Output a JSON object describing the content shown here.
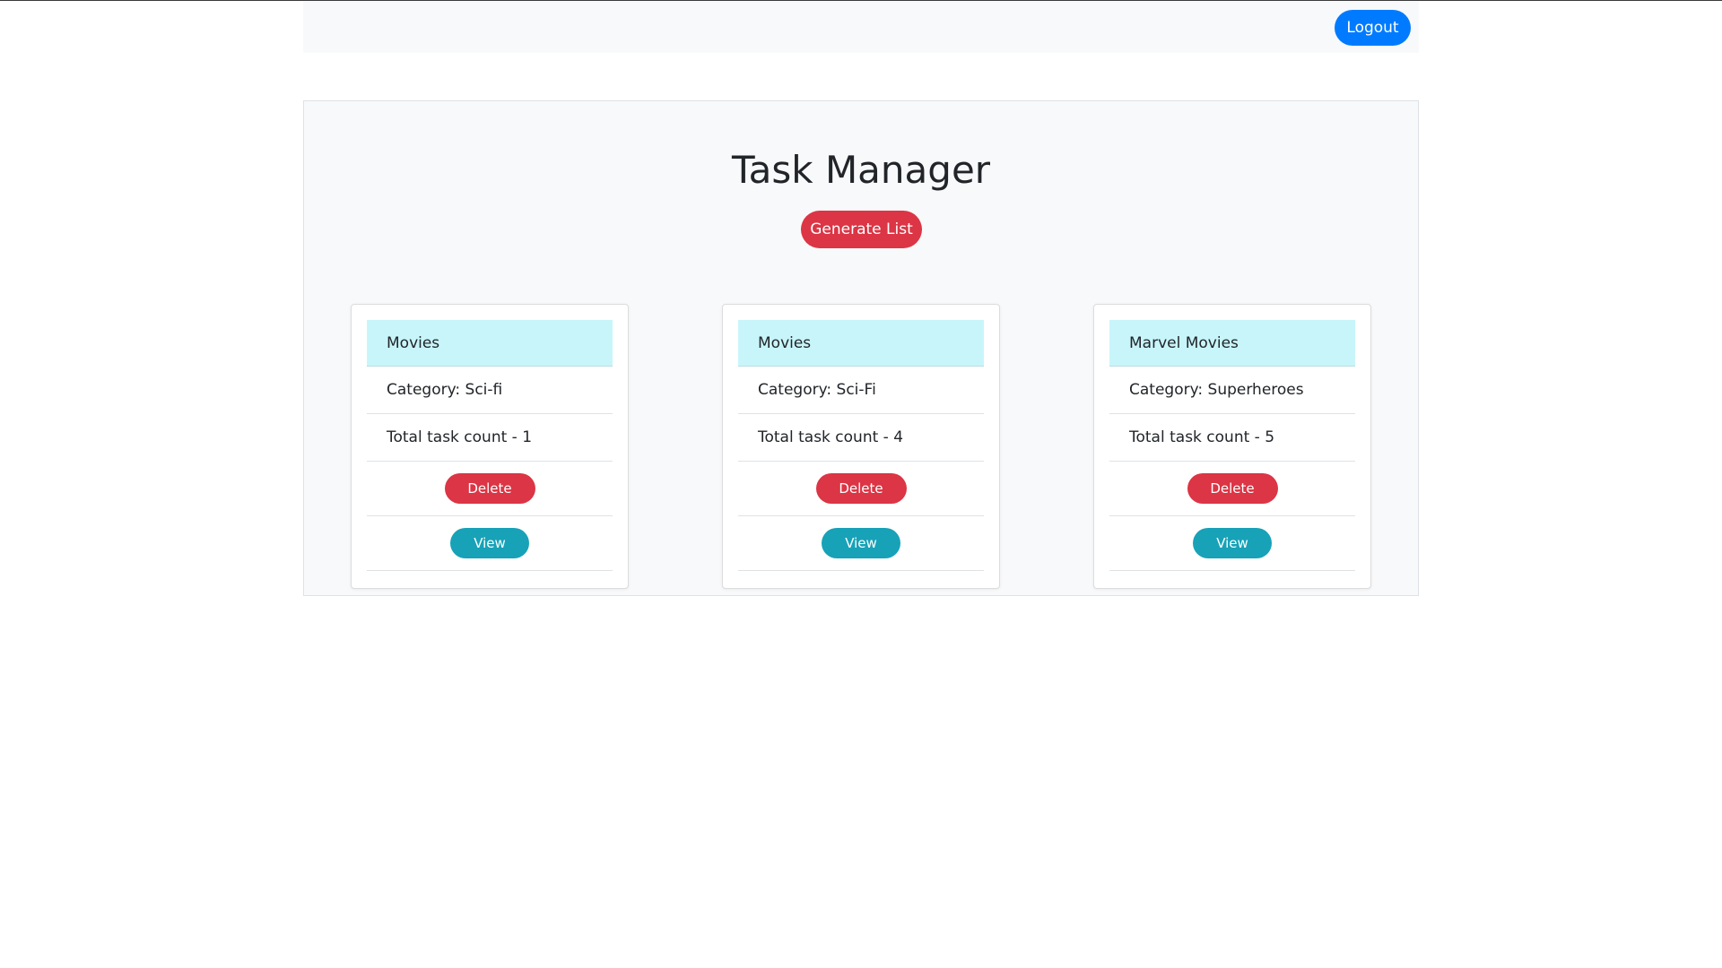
{
  "navbar": {
    "logout_label": "Logout"
  },
  "main": {
    "title": "Task Manager",
    "generate_label": "Generate List"
  },
  "cards": [
    {
      "title": "Movies",
      "category": "Category: Sci-fi",
      "count": "Total task count - 1",
      "delete_label": "Delete",
      "view_label": "View"
    },
    {
      "title": "Movies",
      "category": "Category: Sci-Fi",
      "count": "Total task count - 4",
      "delete_label": "Delete",
      "view_label": "View"
    },
    {
      "title": "Marvel Movies",
      "category": "Category: Superheroes",
      "count": "Total task count - 5",
      "delete_label": "Delete",
      "view_label": "View"
    }
  ],
  "colors": {
    "primary": "#007bff",
    "danger": "#dc3545",
    "info": "#17a2b8",
    "card_header": "#c8f5fa",
    "panel_bg": "#f8f9fa"
  }
}
